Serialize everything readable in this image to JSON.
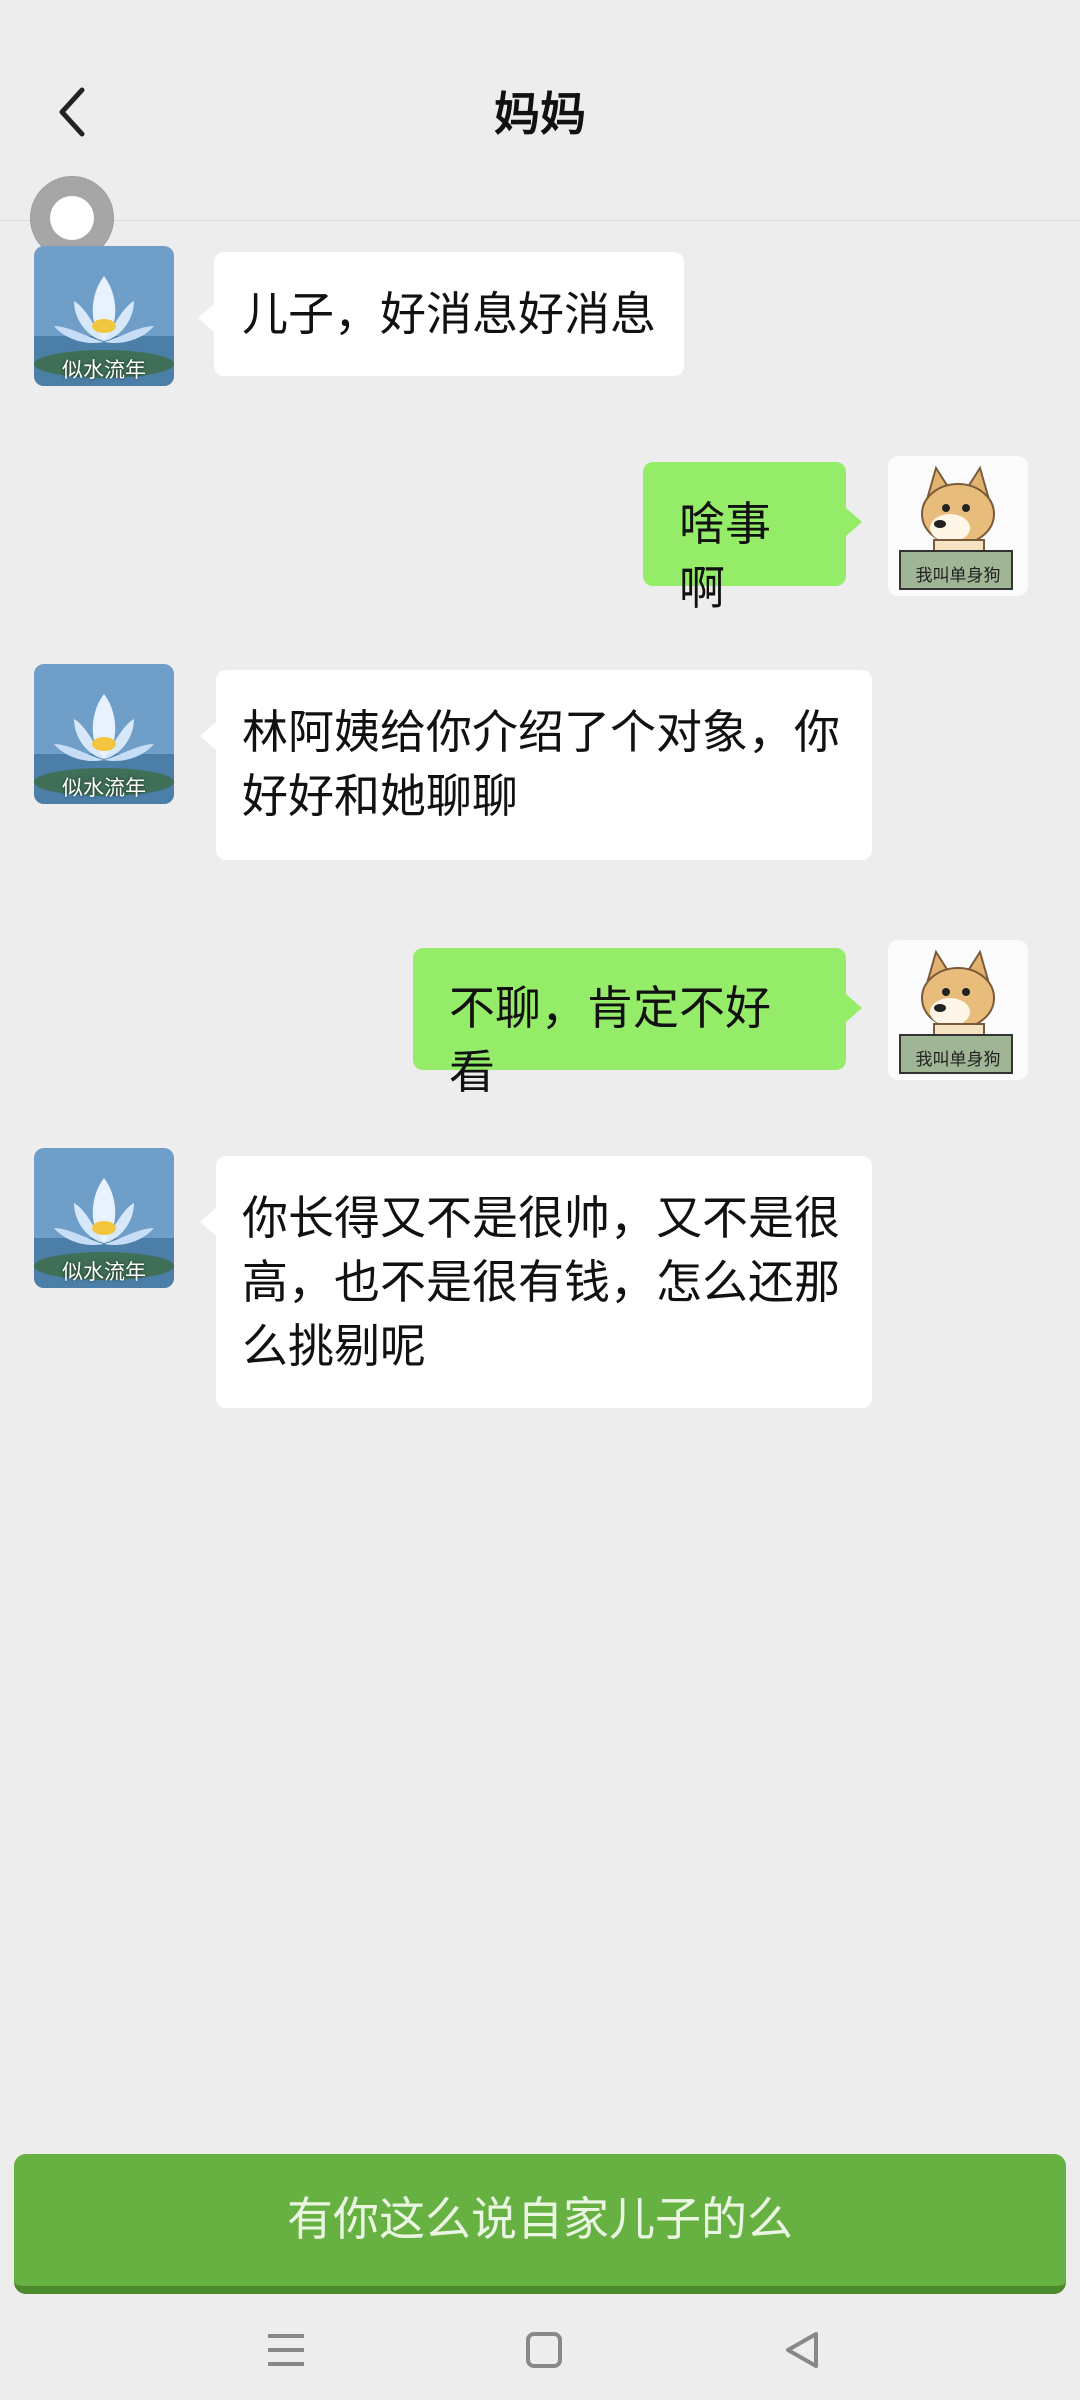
{
  "header": {
    "title": "妈妈"
  },
  "contact_avatar_caption": "似水流年",
  "self_avatar_sign": "我叫单身狗",
  "messages": [
    {
      "side": "left",
      "text": "儿子，好消息好消息"
    },
    {
      "side": "right",
      "text": "啥事啊"
    },
    {
      "side": "left",
      "lines": [
        "林阿姨给你介绍了个对象，你",
        "好好和她聊聊"
      ]
    },
    {
      "side": "right",
      "text": "不聊，肯定不好看"
    },
    {
      "side": "left",
      "lines": [
        "你长得又不是很帅，又不是很",
        "高，也不是很有钱，怎么还那",
        "么挑剔呢"
      ]
    }
  ],
  "bottom_button": {
    "label": "有你这么说自家儿子的么"
  },
  "colors": {
    "background": "#ededed",
    "incoming_bubble": "#ffffff",
    "outgoing_bubble": "#95ec69",
    "bottom_button": "#67b143"
  },
  "icons": [
    "back-icon",
    "floating-assist-icon",
    "lotus-avatar",
    "doge-avatar",
    "menu-icon",
    "home-icon",
    "back-triangle-icon"
  ]
}
